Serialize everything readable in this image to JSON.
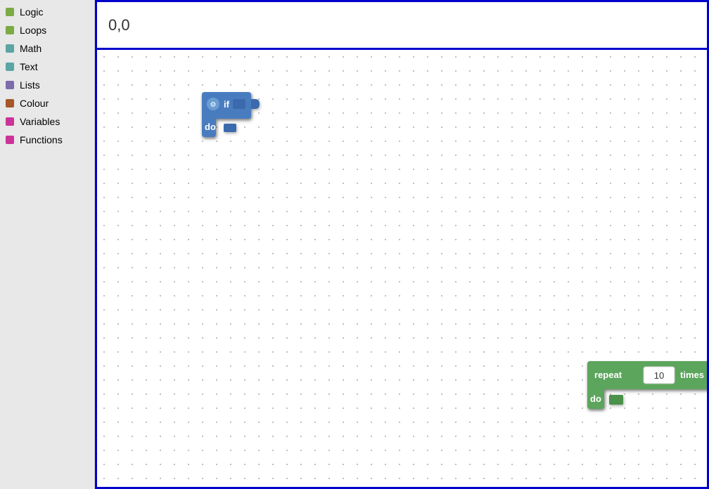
{
  "sidebar": {
    "items": [
      {
        "label": "Logic",
        "color": "#7aab45",
        "id": "logic"
      },
      {
        "label": "Loops",
        "color": "#7aab45",
        "id": "loops"
      },
      {
        "label": "Math",
        "color": "#5ba5a5",
        "id": "math"
      },
      {
        "label": "Text",
        "color": "#5ba5a5",
        "id": "text"
      },
      {
        "label": "Lists",
        "color": "#7c6cac",
        "id": "lists"
      },
      {
        "label": "Colour",
        "color": "#a5572a",
        "id": "colour"
      },
      {
        "label": "Variables",
        "color": "#cc3399",
        "id": "variables"
      },
      {
        "label": "Functions",
        "color": "#cc3399",
        "id": "functions"
      }
    ]
  },
  "workspace": {
    "coord_label": "0,0"
  },
  "blocks": {
    "if_block": {
      "label_if": "if",
      "label_do": "do"
    },
    "repeat_block": {
      "label_repeat": "repeat",
      "label_times": "times",
      "label_do": "do",
      "value": "10"
    }
  }
}
